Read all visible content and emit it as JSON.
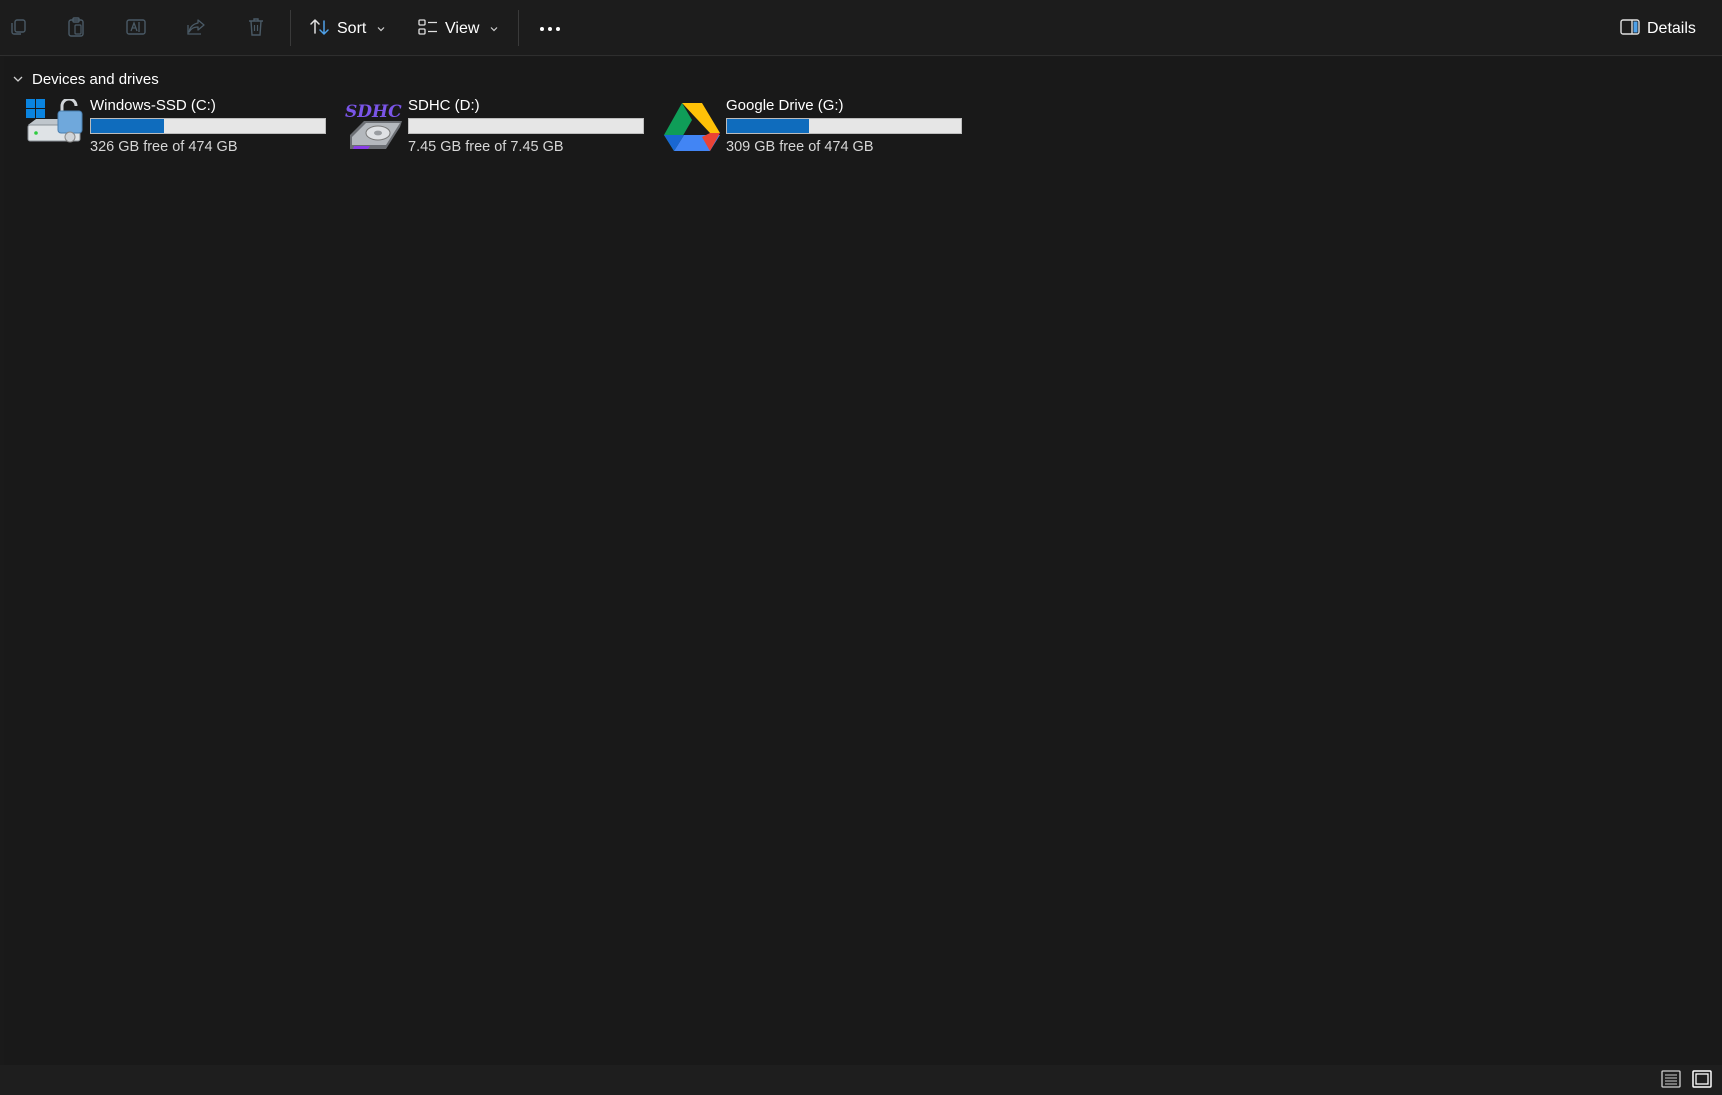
{
  "toolbar": {
    "copy_icon": "copy-icon",
    "paste_icon": "paste-icon",
    "rename_icon": "rename-icon",
    "share_icon": "share-icon",
    "delete_icon": "delete-icon",
    "sort_label": "Sort",
    "view_label": "View",
    "more_icon": "more-icon",
    "details_label": "Details"
  },
  "group": {
    "label": "Devices and drives"
  },
  "drives": [
    {
      "name": "Windows-SSD (C:)",
      "free_text": "326 GB free of 474 GB",
      "used_fraction": 0.31,
      "icon": "windows-drive-icon"
    },
    {
      "name": "SDHC (D:)",
      "free_text": "7.45 GB free of 7.45 GB",
      "used_fraction": 0.0,
      "icon": "sdhc-card-icon",
      "icon_text": "SDHC"
    },
    {
      "name": "Google Drive (G:)",
      "free_text": "309 GB free of 474 GB",
      "used_fraction": 0.35,
      "icon": "google-drive-icon"
    }
  ],
  "colors": {
    "accent": "#0f6cbd",
    "background": "#191919",
    "bar_track": "#e6e6e6"
  }
}
